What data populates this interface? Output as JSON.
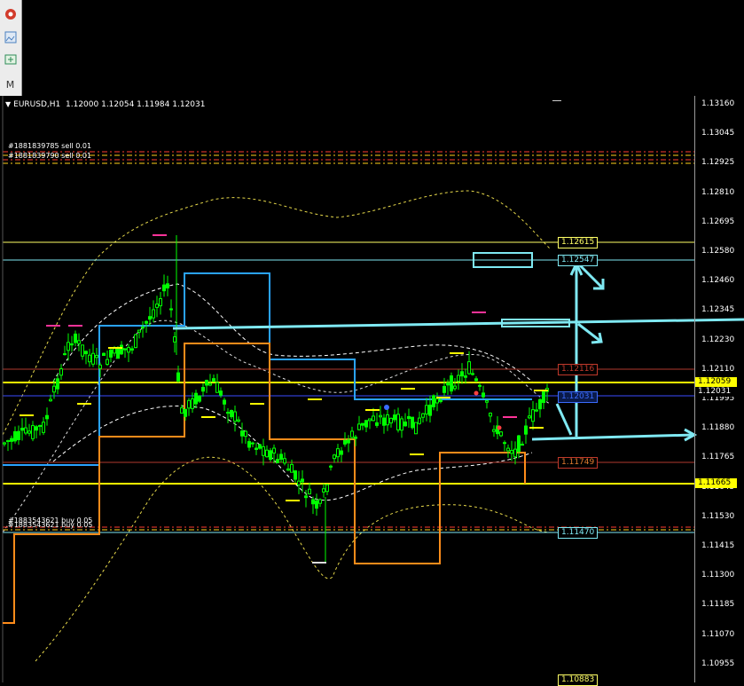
{
  "toolbar": {
    "icons": [
      "settings-gear-icon",
      "image-icon",
      "new-chart-icon"
    ],
    "tab_label": "M"
  },
  "chart": {
    "symbol": "EURUSD,H1",
    "ohlc": "1.12000 1.12054 1.11984 1.12031"
  },
  "price_axis": {
    "ticks": [
      "1.13160",
      "1.13045",
      "1.12925",
      "1.12810",
      "1.12695",
      "1.12580",
      "1.12460",
      "1.12345",
      "1.12230",
      "1.12110",
      "1.11995",
      "1.11880",
      "1.11765",
      "1.11645",
      "1.11530",
      "1.11415",
      "1.11300",
      "1.11185",
      "1.11070",
      "1.10955"
    ],
    "current_bid": "1.12059",
    "current_ask": "1.12031",
    "support_badge": "1.11665"
  },
  "level_labels": {
    "top_resistance": "1.12615",
    "cyan_upper": "1.12547",
    "red_mid": "1.12116",
    "blue_current": "1.12031",
    "red_lower": "1.11749",
    "cyan_lower": "1.11470",
    "bottom": "1.10883"
  },
  "orders": {
    "sell_1": "#1881839785 sell 0.01",
    "sell_2": "#1881839790 sell 0.01",
    "buy_1": "#1883543621 buy 0.05",
    "buy_2": "#1883543621 buy 0.05"
  },
  "colors": {
    "candle_up": "#00ff00",
    "background": "#000000",
    "support_line": "#ffff00",
    "cyan": "#7fe9f3",
    "orange": "#ff8c1a",
    "blue_step": "#2aa3ff",
    "red_level": "#b03a2e"
  }
}
